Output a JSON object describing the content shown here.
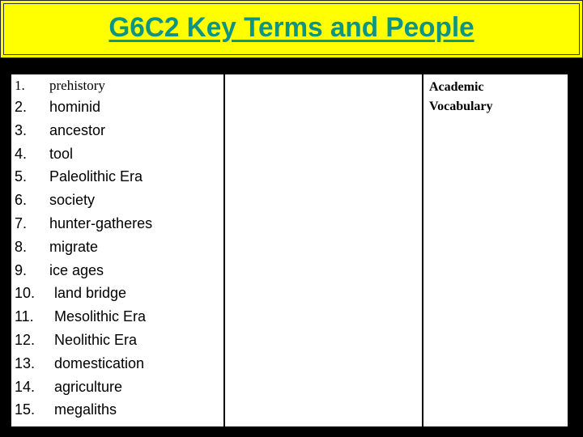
{
  "banner": {
    "title": "G6C2 Key Terms and People",
    "background_color": "#ffff00",
    "title_color": "#0d9482"
  },
  "terms": [
    {
      "number": "1.",
      "text": "prehistory"
    },
    {
      "number": "2.",
      "text": "hominid"
    },
    {
      "number": "3.",
      "text": "ancestor"
    },
    {
      "number": "4.",
      "text": "tool"
    },
    {
      "number": "5.",
      "text": "Paleolithic Era"
    },
    {
      "number": "6.",
      "text": "society"
    },
    {
      "number": "7.",
      "text": "hunter-gatheres"
    },
    {
      "number": "8.",
      "text": "migrate"
    },
    {
      "number": "9.",
      "text": "ice ages"
    },
    {
      "number": "10.",
      "text": "land bridge"
    },
    {
      "number": "11.",
      "text": "Mesolithic Era"
    },
    {
      "number": "12.",
      "text": "Neolithic Era"
    },
    {
      "number": "13.",
      "text": "domestication"
    },
    {
      "number": "14.",
      "text": "agriculture"
    },
    {
      "number": "15.",
      "text": "megaliths"
    }
  ],
  "academic_vocabulary": {
    "line1": "Academic",
    "line2": "Vocabulary"
  }
}
